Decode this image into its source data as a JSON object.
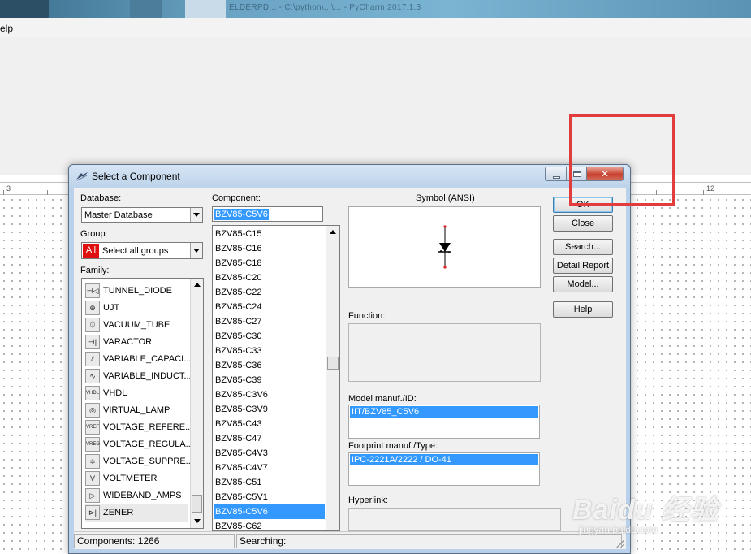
{
  "app": {
    "window_title": "ELDERPD...  -  C:\\python\\...\\... - PyCharm 2017.1.3",
    "menu_help": "elp",
    "ruler_left_number": "3",
    "ruler_right_number": "12"
  },
  "dialog": {
    "title": "Select a Component",
    "database": {
      "label": "Database:",
      "value": "Master Database"
    },
    "group": {
      "label": "Group:",
      "badge": "All",
      "value": "Select all groups"
    },
    "family": {
      "label": "Family:",
      "items": [
        {
          "label": "TUNNEL_DIODE",
          "icon": "tunnel-diode-icon"
        },
        {
          "label": "UJT",
          "icon": "ujt-icon"
        },
        {
          "label": "VACUUM_TUBE",
          "icon": "vacuum-tube-icon"
        },
        {
          "label": "VARACTOR",
          "icon": "varactor-icon"
        },
        {
          "label": "VARIABLE_CAPACI...",
          "icon": "variable-capacitor-icon"
        },
        {
          "label": "VARIABLE_INDUCT...",
          "icon": "variable-inductor-icon"
        },
        {
          "label": "VHDL",
          "icon": "vhdl-icon"
        },
        {
          "label": "VIRTUAL_LAMP",
          "icon": "virtual-lamp-icon"
        },
        {
          "label": "VOLTAGE_REFERE...",
          "icon": "voltage-reference-icon"
        },
        {
          "label": "VOLTAGE_REGULA...",
          "icon": "voltage-regulator-icon"
        },
        {
          "label": "VOLTAGE_SUPPRE...",
          "icon": "voltage-suppressor-icon"
        },
        {
          "label": "VOLTMETER",
          "icon": "voltmeter-icon"
        },
        {
          "label": "WIDEBAND_AMPS",
          "icon": "wideband-amps-icon"
        },
        {
          "label": "ZENER",
          "icon": "zener-icon",
          "selected": true
        }
      ]
    },
    "component": {
      "label": "Component:",
      "search_value": "BZV85-C5V6",
      "items": [
        "BZV85-C15",
        "BZV85-C16",
        "BZV85-C18",
        "BZV85-C20",
        "BZV85-C22",
        "BZV85-C24",
        "BZV85-C27",
        "BZV85-C30",
        "BZV85-C33",
        "BZV85-C36",
        "BZV85-C39",
        "BZV85-C3V6",
        "BZV85-C3V9",
        "BZV85-C43",
        "BZV85-C47",
        "BZV85-C4V3",
        "BZV85-C4V7",
        "BZV85-C51",
        "BZV85-C5V1",
        "BZV85-C5V6",
        "BZV85-C62"
      ],
      "selected": "BZV85-C5V6"
    },
    "symbol": {
      "label": "Symbol (ANSI)"
    },
    "function": {
      "label": "Function:"
    },
    "model": {
      "label": "Model manuf./ID:",
      "value": "IIT/BZV85_C5V6"
    },
    "footprint": {
      "label": "Footprint manuf./Type:",
      "value": "IPC-2221A/2222 / DO-41"
    },
    "hyperlink": {
      "label": "Hyperlink:"
    },
    "buttons": {
      "ok": "OK",
      "close": "Close",
      "search": "Search...",
      "detail_report": "Detail Report",
      "model": "Model...",
      "help": "Help"
    },
    "status": {
      "components": "Components: 1266",
      "searching": "Searching:"
    }
  },
  "watermark": {
    "brand": "Baidu 经验",
    "url": "jingyan.baidu.com"
  },
  "colors": {
    "selection": "#3399ff",
    "annotation": "#e23d3d",
    "dialog_frame": "#b9d1ea"
  }
}
